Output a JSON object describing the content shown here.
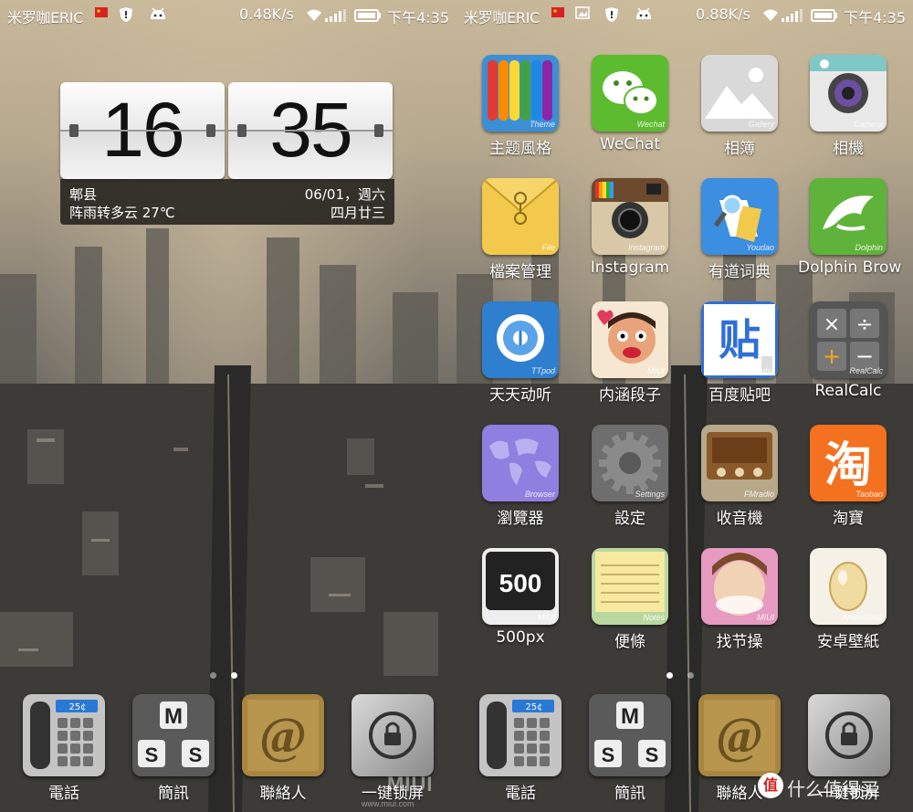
{
  "left": {
    "status": {
      "carrier": "米罗咖ERIC",
      "speed": "0.48K/s",
      "time": "下午4:35"
    },
    "clock": {
      "hour": "16",
      "minute": "35",
      "city": "郫县",
      "weather": "阵雨转多云 27℃",
      "date": "06/01，週六",
      "lunar": "四月廿三"
    },
    "dock": [
      {
        "label": "電話",
        "icon": "phone-icon"
      },
      {
        "label": "簡訊",
        "icon": "sms-icon"
      },
      {
        "label": "聯絡人",
        "icon": "contacts-icon"
      },
      {
        "label": "一键锁屏",
        "icon": "lock-screen-icon"
      }
    ],
    "watermark": "MIUI",
    "watermark_url": "www.miui.com"
  },
  "right": {
    "status": {
      "carrier": "米罗咖ERIC",
      "speed": "0.88K/s",
      "time": "下午4:35"
    },
    "apps": [
      {
        "label": "主题風格",
        "tag": "Theme",
        "icon": "theme-icon"
      },
      {
        "label": "WeChat",
        "tag": "Wechat",
        "icon": "wechat-icon"
      },
      {
        "label": "相簿",
        "tag": "Gallery",
        "icon": "gallery-icon"
      },
      {
        "label": "相機",
        "tag": "Camera",
        "icon": "camera-icon"
      },
      {
        "label": "檔案管理",
        "tag": "File",
        "icon": "file-icon"
      },
      {
        "label": "Instagram",
        "tag": "Instagram",
        "icon": "instagram-icon"
      },
      {
        "label": "有道词典",
        "tag": "Youdao",
        "icon": "youdao-icon"
      },
      {
        "label": "Dolphin Brow",
        "tag": "Dolphin",
        "icon": "dolphin-icon"
      },
      {
        "label": "天天动听",
        "tag": "TTpod",
        "icon": "ttpod-icon"
      },
      {
        "label": "内涵段子",
        "tag": "MIUI",
        "icon": "neihan-icon"
      },
      {
        "label": "百度贴吧",
        "tag": "BaiduTieba",
        "icon": "tieba-icon"
      },
      {
        "label": "RealCalc",
        "tag": "RealCalc",
        "icon": "calculator-icon"
      },
      {
        "label": "瀏覽器",
        "tag": "Browser",
        "icon": "browser-icon"
      },
      {
        "label": "設定",
        "tag": "Settings",
        "icon": "settings-icon"
      },
      {
        "label": "收音機",
        "tag": "FMradio",
        "icon": "radio-icon"
      },
      {
        "label": "淘寶",
        "tag": "Taobao",
        "icon": "taobao-icon"
      },
      {
        "label": "500px",
        "tag": "MIUI",
        "icon": "500px-icon"
      },
      {
        "label": "便條",
        "tag": "Notes",
        "icon": "notes-icon"
      },
      {
        "label": "找节操",
        "tag": "MIUI",
        "icon": "jiecao-icon"
      },
      {
        "label": "安卓壁紙",
        "tag": "Androidesk",
        "icon": "wallpaper-icon"
      }
    ],
    "dock": [
      {
        "label": "電話",
        "icon": "phone-icon"
      },
      {
        "label": "簡訊",
        "icon": "sms-icon"
      },
      {
        "label": "聯絡人",
        "icon": "contacts-icon"
      },
      {
        "label": "一键锁屏",
        "icon": "lock-screen-icon"
      }
    ],
    "watermark": "什么值得买"
  },
  "glyphs": {
    "sms_m": "M",
    "sms_s": "S",
    "at": "@",
    "tieba": "贴",
    "taobao": "淘",
    "five": "500",
    "calc_times": "×",
    "calc_div": "÷",
    "calc_plus": "+",
    "calc_minus": "−",
    "zhi": "值",
    "phone_display": "25¢"
  }
}
